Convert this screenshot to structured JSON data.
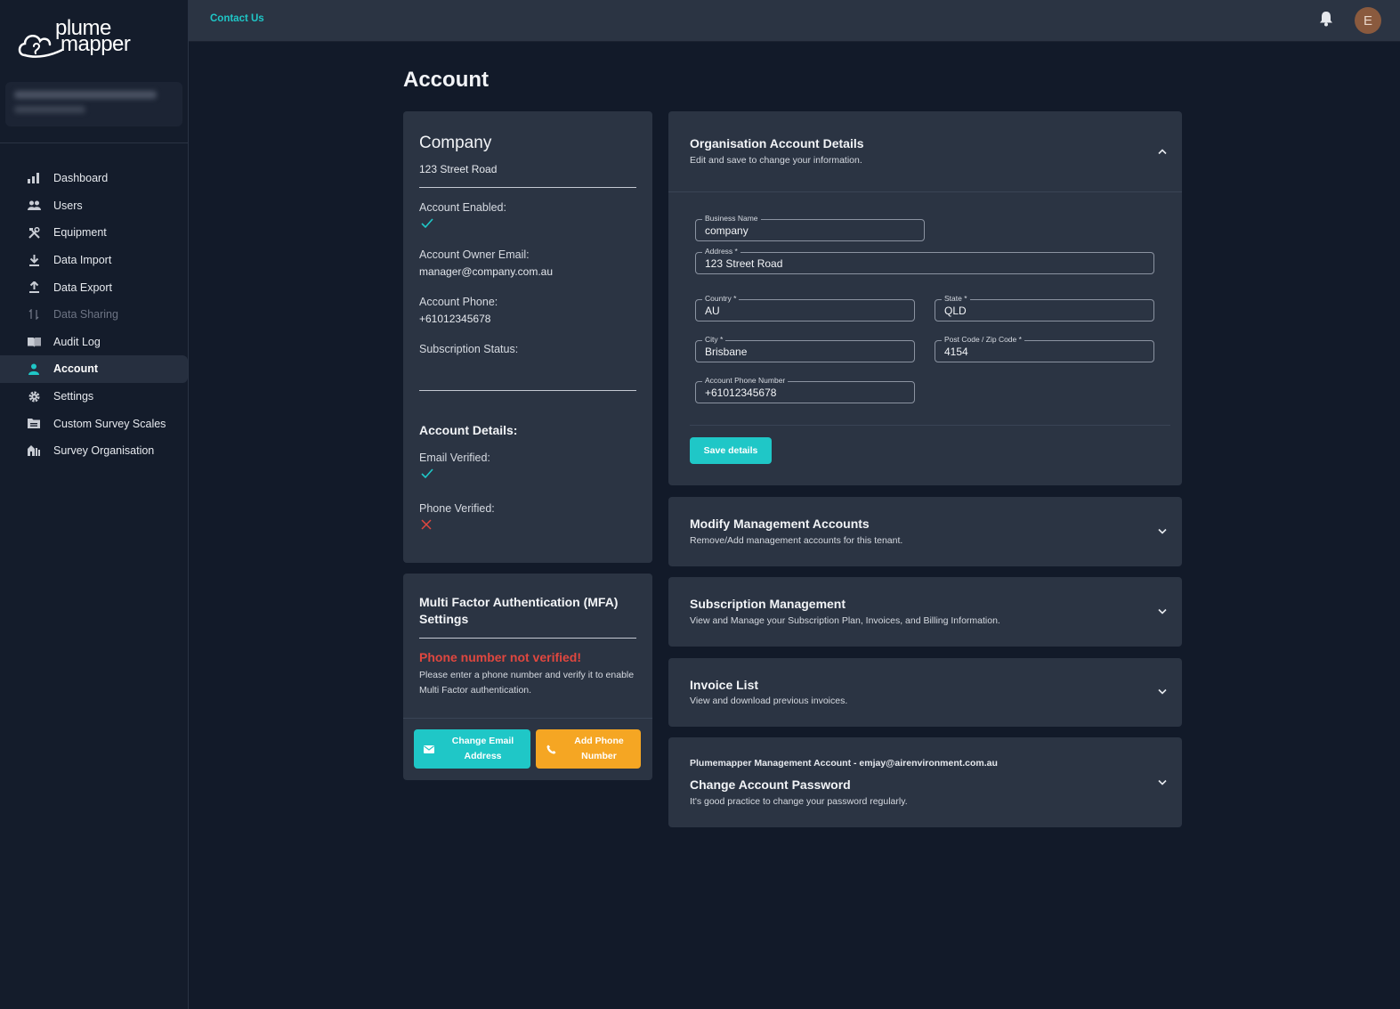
{
  "brand": {
    "line1": "plume",
    "line2": "mapper"
  },
  "user": {
    "initial": "E"
  },
  "topbar": {
    "contact_label": "Contact Us"
  },
  "sidebar": {
    "items": [
      {
        "label": "Dashboard",
        "icon": "bar-chart-icon"
      },
      {
        "label": "Users",
        "icon": "users-icon"
      },
      {
        "label": "Equipment",
        "icon": "tools-icon"
      },
      {
        "label": "Data Import",
        "icon": "download-icon"
      },
      {
        "label": "Data Export",
        "icon": "upload-icon"
      },
      {
        "label": "Data Sharing",
        "icon": "swap-icon",
        "disabled": true
      },
      {
        "label": "Audit Log",
        "icon": "book-icon"
      },
      {
        "label": "Account",
        "icon": "person-icon",
        "active": true
      },
      {
        "label": "Settings",
        "icon": "gear-icon"
      },
      {
        "label": "Custom Survey Scales",
        "icon": "folder-icon"
      },
      {
        "label": "Survey Organisation",
        "icon": "buildings-icon"
      }
    ]
  },
  "page": {
    "title": "Account"
  },
  "company": {
    "name": "Company",
    "address": "123 Street Road",
    "account_enabled_label": "Account Enabled:",
    "owner_email_label": "Account Owner Email:",
    "owner_email": "manager@company.com.au",
    "phone_label": "Account Phone:",
    "phone": "+61012345678",
    "subscription_label": "Subscription Status:",
    "details_heading": "Account Details:",
    "email_verified_label": "Email Verified:",
    "phone_verified_label": "Phone Verified:"
  },
  "mfa": {
    "title": "Multi Factor Authentication (MFA) Settings",
    "warning": "Phone number not verified!",
    "description": "Please enter a phone number and verify it to enable Multi Factor authentication.",
    "change_email_label": "Change Email Address",
    "add_phone_label": "Add Phone Number"
  },
  "org": {
    "title": "Organisation Account Details",
    "subtitle": "Edit and save to change your information.",
    "fields": {
      "business_name": {
        "label": "Business Name",
        "value": "company"
      },
      "address": {
        "label": "Address *",
        "value": "123 Street Road"
      },
      "country": {
        "label": "Country *",
        "value": "AU"
      },
      "state": {
        "label": "State *",
        "value": "QLD"
      },
      "city": {
        "label": "City *",
        "value": "Brisbane"
      },
      "postcode": {
        "label": "Post Code / Zip Code *",
        "value": "4154"
      },
      "phone": {
        "label": "Account Phone Number",
        "value": "+61012345678"
      }
    },
    "save_label": "Save details"
  },
  "management": {
    "title": "Modify Management Accounts",
    "subtitle": "Remove/Add management accounts for this tenant."
  },
  "subscription": {
    "title": "Subscription Management",
    "subtitle": "View and Manage your Subscription Plan, Invoices, and Billing Information."
  },
  "invoices": {
    "title": "Invoice List",
    "subtitle": "View and download previous invoices."
  },
  "password": {
    "owner": "Plumemapper Management Account - emjay@airenvironment.com.au",
    "title": "Change Account Password",
    "subtitle": "It's good practice to change your password regularly."
  },
  "colors": {
    "accent": "#1fc7c7",
    "warning": "#f5a623",
    "error": "#e0473f",
    "background": "#121a29",
    "card": "#2b3443"
  }
}
